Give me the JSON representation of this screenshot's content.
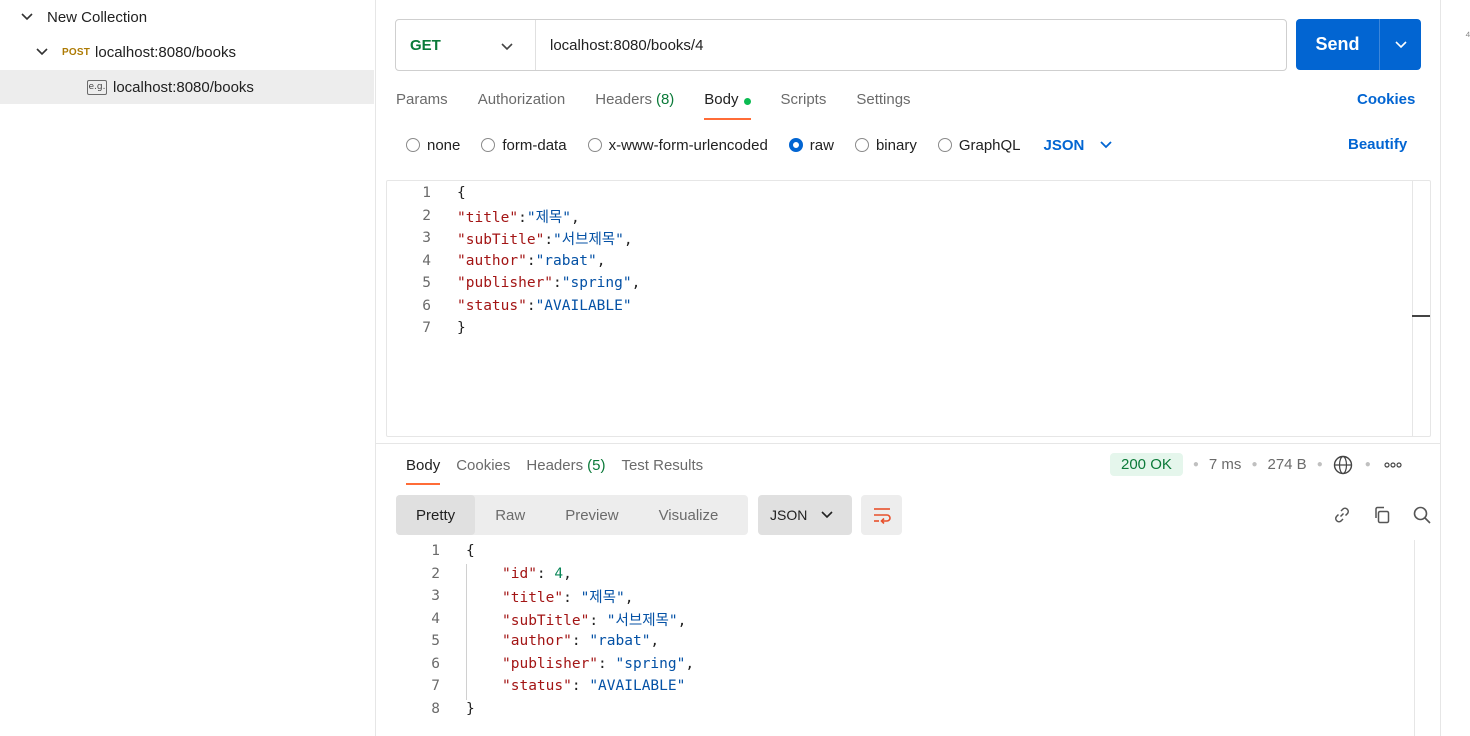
{
  "sidebar": {
    "collection_name": "New Collection",
    "request": {
      "method": "POST",
      "name": "localhost:8080/books"
    },
    "example": {
      "badge": "e.g.",
      "name": "localhost:8080/books"
    }
  },
  "request": {
    "method": "GET",
    "url": "localhost:8080/books/4",
    "send_label": "Send",
    "tabs": [
      {
        "label": "Params"
      },
      {
        "label": "Authorization"
      },
      {
        "label": "Headers",
        "count": "(8)"
      },
      {
        "label": "Body"
      },
      {
        "label": "Scripts"
      },
      {
        "label": "Settings"
      }
    ],
    "active_tab": "Body",
    "cookies_label": "Cookies",
    "body_types": [
      "none",
      "form-data",
      "x-www-form-urlencoded",
      "raw",
      "binary",
      "GraphQL"
    ],
    "selected_body_type": "raw",
    "raw_format": "JSON",
    "beautify_label": "Beautify",
    "body_lines": [
      {
        "n": "1",
        "text": "{"
      },
      {
        "n": "2",
        "key": "\"title\"",
        "sep": ":",
        "val": "\"제목\"",
        "end": ","
      },
      {
        "n": "3",
        "key": "\"subTitle\"",
        "sep": ":",
        "val": "\"서브제목\"",
        "end": ","
      },
      {
        "n": "4",
        "key": "\"author\"",
        "sep": ":",
        "val": "\"rabat\"",
        "end": ","
      },
      {
        "n": "5",
        "key": "\"publisher\"",
        "sep": ":",
        "val": "\"spring\"",
        "end": ","
      },
      {
        "n": "6",
        "key": "\"status\"",
        "sep": ":",
        "val": "\"AVAILABLE\"",
        "end": ""
      },
      {
        "n": "7",
        "text": "}"
      }
    ]
  },
  "response": {
    "tabs": [
      {
        "label": "Body"
      },
      {
        "label": "Cookies"
      },
      {
        "label": "Headers",
        "count": "(5)"
      },
      {
        "label": "Test Results"
      }
    ],
    "active_tab": "Body",
    "status": "200 OK",
    "time": "7 ms",
    "size": "274 B",
    "view_modes": [
      "Pretty",
      "Raw",
      "Preview",
      "Visualize"
    ],
    "active_view": "Pretty",
    "format": "JSON",
    "body_lines": [
      {
        "n": "1",
        "text": "{"
      },
      {
        "n": "2",
        "key": "\"id\"",
        "sep": ": ",
        "num": "4",
        "end": ","
      },
      {
        "n": "3",
        "key": "\"title\"",
        "sep": ": ",
        "val": "\"제목\"",
        "end": ","
      },
      {
        "n": "4",
        "key": "\"subTitle\"",
        "sep": ": ",
        "val": "\"서브제목\"",
        "end": ","
      },
      {
        "n": "5",
        "key": "\"author\"",
        "sep": ": ",
        "val": "\"rabat\"",
        "end": ","
      },
      {
        "n": "6",
        "key": "\"publisher\"",
        "sep": ": ",
        "val": "\"spring\"",
        "end": ","
      },
      {
        "n": "7",
        "key": "\"status\"",
        "sep": ": ",
        "val": "\"AVAILABLE\"",
        "end": ""
      },
      {
        "n": "8",
        "text": "}"
      }
    ]
  },
  "right_strip": {
    "glyph": "⁴"
  },
  "colors": {
    "accent": "#0265d2",
    "tab_indicator": "#ff6c37",
    "success": "#0b7a39",
    "post_method": "#ad7a03"
  }
}
